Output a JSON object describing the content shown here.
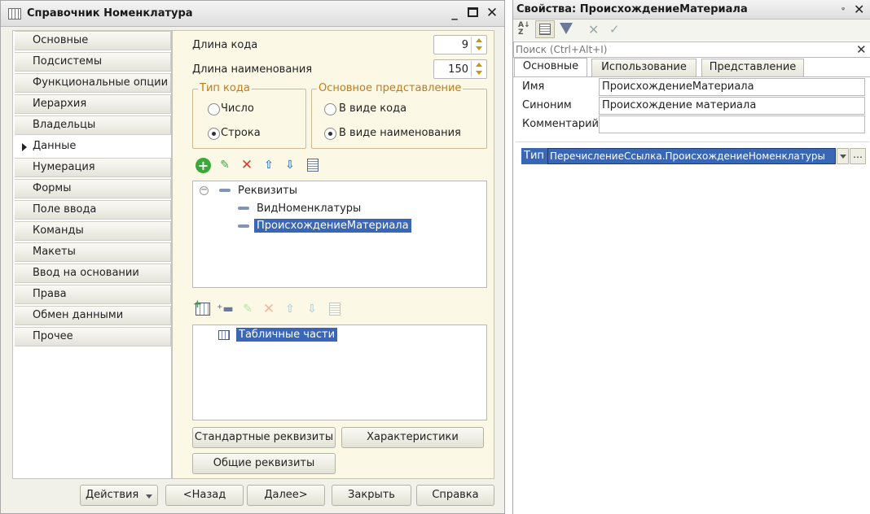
{
  "catalog_window": {
    "title": "Справочник Номенклатура",
    "nav_items": [
      {
        "label": "Основные"
      },
      {
        "label": "Подсистемы"
      },
      {
        "label": "Функциональные опции"
      },
      {
        "label": "Иерархия"
      },
      {
        "label": "Владельцы"
      },
      {
        "label": "Данные",
        "selected": true
      },
      {
        "label": "Нумерация"
      },
      {
        "label": "Формы"
      },
      {
        "label": "Поле ввода"
      },
      {
        "label": "Команды"
      },
      {
        "label": "Макеты"
      },
      {
        "label": "Ввод на основании"
      },
      {
        "label": "Права"
      },
      {
        "label": "Обмен данными"
      },
      {
        "label": "Прочее"
      }
    ],
    "code_length": {
      "label": "Длина кода",
      "value": "9"
    },
    "name_length": {
      "label": "Длина наименования",
      "value": "150"
    },
    "code_type": {
      "title": "Тип кода",
      "options": [
        "Число",
        "Строка"
      ],
      "selected": "Строка"
    },
    "main_presentation": {
      "title": "Основное представление",
      "options": [
        "В виде кода",
        "В виде наименования"
      ],
      "selected": "В виде наименования"
    },
    "attributes_tree": {
      "root": "Реквизиты",
      "items": [
        "ВидНоменклатуры",
        "ПроисхождениеМатериала"
      ],
      "selected": "ПроисхождениеМатериала"
    },
    "tabular_tree": {
      "root": "Табличные части"
    },
    "buttons": {
      "standard_attributes": "Стандартные реквизиты",
      "characteristics": "Характеристики",
      "common_attributes": "Общие реквизиты"
    },
    "footer": {
      "actions": "Действия",
      "back": "<Назад",
      "next": "Далее>",
      "close": "Закрыть",
      "help": "Справка"
    }
  },
  "properties_window": {
    "title": "Свойства: ПроисхождениеМатериала",
    "search_placeholder": "Поиск (Ctrl+Alt+I)",
    "tabs": [
      "Основные",
      "Использование",
      "Представление"
    ],
    "active_tab": "Основные",
    "name": {
      "label": "Имя",
      "value": "ПроисхождениеМатериала"
    },
    "synonym": {
      "label": "Синоним",
      "value": "Происхождение материала"
    },
    "comment": {
      "label": "Комментарий",
      "value": ""
    },
    "type": {
      "label": "Тип",
      "value": "ПеречислениеСсылка.ПроисхождениеНоменклатуры"
    }
  },
  "colors": {
    "selection": "#3a66b6",
    "content_bg": "#fbf9e5",
    "group_title": "#c07a1a",
    "add_icon": "#3aa83a",
    "delete_icon": "#d93a2a",
    "arrow_icon": "#3a7fd0"
  }
}
